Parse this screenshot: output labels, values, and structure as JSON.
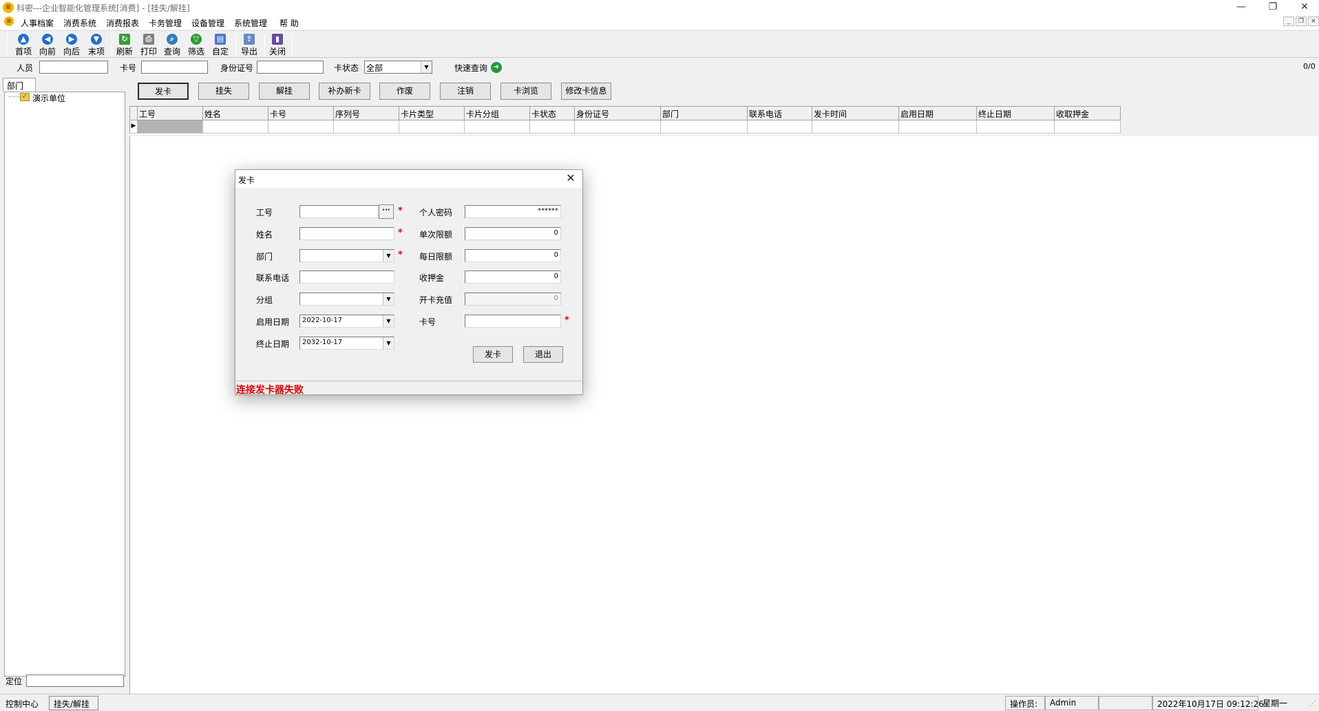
{
  "window": {
    "title": "科密---企业智能化管理系统[消费] - [挂失/解挂]",
    "icon": "app-logo-icon",
    "controls": [
      "—",
      "❐",
      "✕"
    ]
  },
  "menu": {
    "items": [
      "人事档案",
      "消费系统",
      "消费报表",
      "卡务管理",
      "设备管理",
      "系统管理",
      "帮 助"
    ],
    "mdi_controls": [
      "_",
      "❐",
      "×"
    ]
  },
  "toolbar": {
    "buttons": [
      {
        "label": "首项",
        "icon": "first-record-icon",
        "color": "#1f6fd1",
        "glyph": "▲"
      },
      {
        "label": "向前",
        "icon": "previous-record-icon",
        "color": "#1f6fd1",
        "glyph": "◀"
      },
      {
        "label": "向后",
        "icon": "next-record-icon",
        "color": "#1f6fd1",
        "glyph": "▶"
      },
      {
        "label": "末项",
        "icon": "last-record-icon",
        "color": "#1f6fd1",
        "glyph": "▼"
      },
      {
        "label": "刷新",
        "icon": "refresh-icon",
        "color": "#3a9a3a",
        "glyph": "↻"
      },
      {
        "label": "打印",
        "icon": "print-icon",
        "color": "#808080",
        "glyph": "⎙"
      },
      {
        "label": "查询",
        "icon": "search-icon",
        "color": "#2f7fbf",
        "glyph": "⌕"
      },
      {
        "label": "筛选",
        "icon": "filter-icon",
        "color": "#2d9a2d",
        "glyph": "▽"
      },
      {
        "label": "自定",
        "icon": "customize-icon",
        "color": "#4a78c8",
        "glyph": "▤"
      },
      {
        "label": "导出",
        "icon": "export-icon",
        "color": "#6a8acb",
        "glyph": "⇪"
      },
      {
        "label": "关闭",
        "icon": "close-door-icon",
        "color": "#6a4aa8",
        "glyph": "▮"
      }
    ]
  },
  "filters": {
    "person_label": "人员",
    "card_label": "卡号",
    "idcard_label": "身份证号",
    "card_status_label": "卡状态",
    "card_status_value": "全部",
    "quick_search_label": "快速查询",
    "record_count": "0/0"
  },
  "left_panel": {
    "tab_label": "部门",
    "tree_root": "演示单位",
    "locate_label": "定位"
  },
  "actions": [
    "发卡",
    "挂失",
    "解挂",
    "补办新卡",
    "作废",
    "注销",
    "卡浏览",
    "修改卡信息"
  ],
  "grid": {
    "columns": [
      "工号",
      "姓名",
      "卡号",
      "序列号",
      "卡片类型",
      "卡片分组",
      "卡状态",
      "身份证号",
      "部门",
      "联系电话",
      "发卡时间",
      "启用日期",
      "终止日期",
      "收取押金"
    ]
  },
  "dialog": {
    "title": "发卡",
    "fields_left": [
      {
        "label": "工号",
        "value": "",
        "required": true
      },
      {
        "label": "姓名",
        "value": "",
        "required": true
      },
      {
        "label": "部门",
        "value": "",
        "required": true
      },
      {
        "label": "联系电话",
        "value": "",
        "required": false
      },
      {
        "label": "分组",
        "value": "",
        "required": false
      },
      {
        "label": "启用日期",
        "value": "2022-10-17",
        "required": false
      },
      {
        "label": "终止日期",
        "value": "2032-10-17",
        "required": false
      }
    ],
    "fields_right": [
      {
        "label": "个人密码",
        "value": "******"
      },
      {
        "label": "单次限额",
        "value": "0"
      },
      {
        "label": "每日限额",
        "value": "0"
      },
      {
        "label": "收押金",
        "value": "0"
      },
      {
        "label": "开卡充值",
        "value": "0"
      },
      {
        "label": "卡号",
        "value": ""
      }
    ],
    "issue_button": "发卡",
    "exit_button": "退出",
    "status_message": "连接发卡器失败",
    "required_mark": "*",
    "ellipsis": "···"
  },
  "statusbar": {
    "control_center": "控制中心",
    "current_module": "挂失/解挂",
    "operator_label": "操作员:",
    "operator_value": "Admin",
    "datetime": "2022年10月17日 09:12:26",
    "weekday": "星期一"
  },
  "colors": {
    "error_red": "#e00000",
    "selected_row": "#b4b4b4",
    "quick_search_green": "#1f9a3a"
  }
}
